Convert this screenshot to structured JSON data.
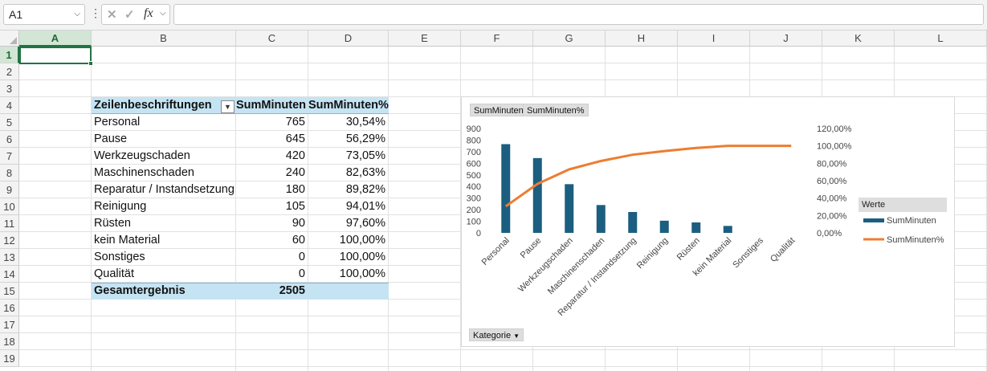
{
  "name_box": "A1",
  "formula_icons": {
    "cancel": "✕",
    "confirm": "✓",
    "fx": "fx"
  },
  "formula_value": "",
  "columns": [
    "A",
    "B",
    "C",
    "D",
    "E",
    "F",
    "G",
    "H",
    "I",
    "J",
    "K",
    "L"
  ],
  "rows": [
    "1",
    "2",
    "3",
    "4",
    "5",
    "6",
    "7",
    "8",
    "9",
    "10",
    "11",
    "12",
    "13",
    "14",
    "15",
    "16",
    "17",
    "18",
    "19"
  ],
  "pivot": {
    "header": {
      "label": "Zeilenbeschriftungen",
      "sum": "SumMinuten",
      "pct": "SumMinuten%"
    },
    "rows": [
      {
        "label": "Personal",
        "sum": "765",
        "pct": "30,54%"
      },
      {
        "label": "Pause",
        "sum": "645",
        "pct": "56,29%"
      },
      {
        "label": "Werkzeugschaden",
        "sum": "420",
        "pct": "73,05%"
      },
      {
        "label": "Maschinenschaden",
        "sum": "240",
        "pct": "82,63%"
      },
      {
        "label": "Reparatur / Instandsetzung",
        "sum": "180",
        "pct": "89,82%"
      },
      {
        "label": "Reinigung",
        "sum": "105",
        "pct": "94,01%"
      },
      {
        "label": "Rüsten",
        "sum": "90",
        "pct": "97,60%"
      },
      {
        "label": "kein Material",
        "sum": "60",
        "pct": "100,00%"
      },
      {
        "label": "Sonstiges",
        "sum": "0",
        "pct": "100,00%"
      },
      {
        "label": "Qualität",
        "sum": "0",
        "pct": "100,00%"
      }
    ],
    "total": {
      "label": "Gesamtergebnis",
      "sum": "2505",
      "pct": ""
    }
  },
  "chart_field_buttons": {
    "values1": "SumMinuten",
    "values2": "SumMinuten%",
    "axis": "Kategorie"
  },
  "chart_data": {
    "type": "bar",
    "categories": [
      "Personal",
      "Pause",
      "Werkzeugschaden",
      "Maschinenschaden",
      "Reparatur / Instandsetzung",
      "Reinigung",
      "Rüsten",
      "kein Material",
      "Sonstiges",
      "Qualität"
    ],
    "series": [
      {
        "name": "SumMinuten",
        "type": "bar",
        "axis": "left",
        "values": [
          765,
          645,
          420,
          240,
          180,
          105,
          90,
          60,
          0,
          0
        ],
        "color": "#1b5e80"
      },
      {
        "name": "SumMinuten%",
        "type": "line",
        "axis": "right",
        "values": [
          30.54,
          56.29,
          73.05,
          82.63,
          89.82,
          94.01,
          97.6,
          100,
          100,
          100
        ],
        "color": "#ed7d31"
      }
    ],
    "y_left": {
      "min": 0,
      "max": 900,
      "ticks": [
        "0",
        "100",
        "200",
        "300",
        "400",
        "500",
        "600",
        "700",
        "800",
        "900"
      ]
    },
    "y_right": {
      "min": 0,
      "max": 120,
      "ticks": [
        "0,00%",
        "20,00%",
        "40,00%",
        "60,00%",
        "80,00%",
        "100,00%",
        "120,00%"
      ]
    },
    "legend": {
      "title": "Werte",
      "position": "right"
    },
    "grid": false
  }
}
